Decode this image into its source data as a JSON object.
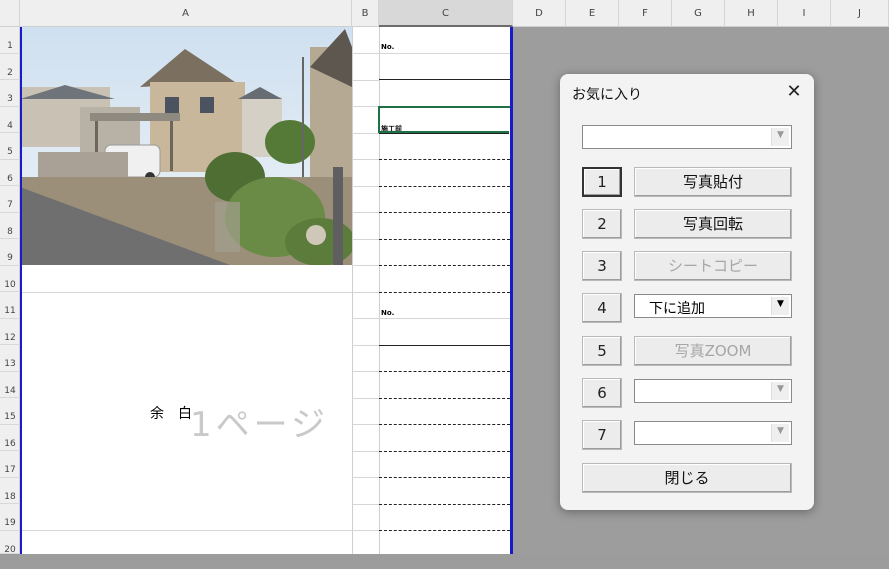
{
  "columns": [
    "A",
    "B",
    "C",
    "D",
    "E",
    "F",
    "G",
    "H",
    "I",
    "J"
  ],
  "rows": [
    "1",
    "2",
    "3",
    "4",
    "5",
    "6",
    "7",
    "8",
    "9",
    "10",
    "11",
    "12",
    "13",
    "14",
    "15",
    "16",
    "17",
    "18",
    "19",
    "20"
  ],
  "sheet": {
    "label_no_1": "No.",
    "label_no_2": "No.",
    "label_koji": "施工前",
    "margin_text": "余　白",
    "page_watermark": "1ページ"
  },
  "dialog": {
    "title": "お気に入り",
    "close_glyph": "✕",
    "top_combo_value": "",
    "rows": [
      {
        "num": "1",
        "label": "写真貼付",
        "enabled": true
      },
      {
        "num": "2",
        "label": "写真回転",
        "enabled": true
      },
      {
        "num": "3",
        "label": "シートコピー",
        "enabled": false
      },
      {
        "num": "4",
        "label": "下に追加",
        "enabled": true
      },
      {
        "num": "5",
        "label": "写真ZOOM",
        "enabled": false
      },
      {
        "num": "6",
        "label": "",
        "enabled": false
      },
      {
        "num": "7",
        "label": "",
        "enabled": false
      }
    ],
    "close_label": "閉じる"
  },
  "colors": {
    "selection": "#1e7145",
    "page_border": "#1a1acd"
  }
}
